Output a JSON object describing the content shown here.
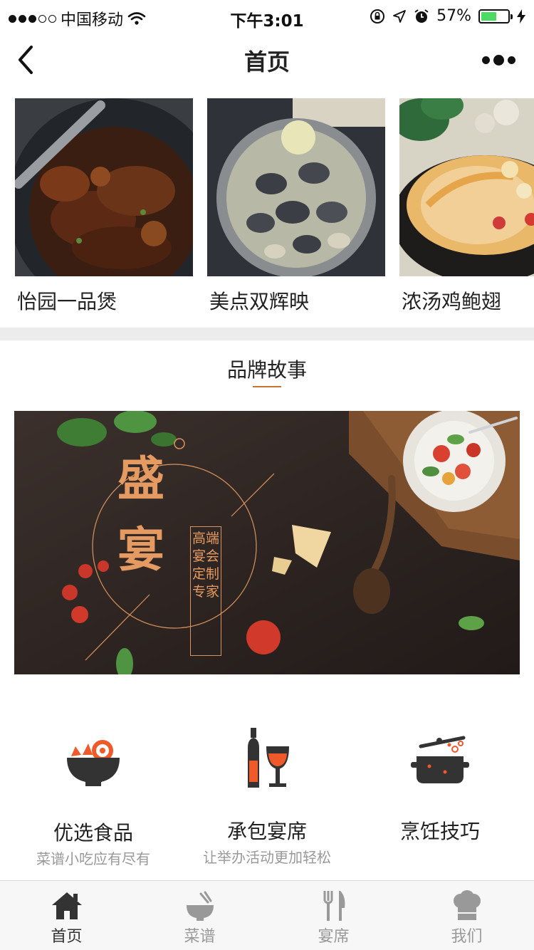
{
  "status_bar": {
    "carrier": "中国移动",
    "time": "下午3:01",
    "battery_percent": "57%",
    "battery_level": 0.57,
    "signal_bars_filled": 3,
    "signal_bars_total": 5
  },
  "nav": {
    "title": "首页"
  },
  "products": [
    {
      "name": "怡园一品煲",
      "image": "braised-meat-pot-photo"
    },
    {
      "name": "美点双辉映",
      "image": "clams-pan-photo"
    },
    {
      "name": "浓汤鸡鲍翅",
      "image": "chicken-soup-pot-photo"
    }
  ],
  "brand_story": {
    "title": "品牌故事",
    "banner": {
      "char_1": "盛",
      "char_2": "宴",
      "vertical_text": "高端宴会定制专家"
    }
  },
  "features": [
    {
      "title": "优选食品",
      "desc": "菜谱小吃应有尽有",
      "icon": "food-bowl-icon"
    },
    {
      "title": "承包宴席",
      "desc": "让举办活动更加轻松",
      "icon": "wine-icon"
    },
    {
      "title": "烹饪技巧",
      "desc": "",
      "icon": "cooking-pot-icon"
    }
  ],
  "tabs": [
    {
      "label": "首页",
      "icon": "home-icon",
      "active": true
    },
    {
      "label": "菜谱",
      "icon": "bowl-icon",
      "active": false
    },
    {
      "label": "宴席",
      "icon": "cutlery-icon",
      "active": false
    },
    {
      "label": "我们",
      "icon": "chef-hat-icon",
      "active": false
    }
  ],
  "colors": {
    "accent": "#c8742f",
    "icon_orange": "#f0592a",
    "icon_dark": "#333333",
    "tab_inactive": "#999999",
    "battery_green": "#4cd964"
  }
}
